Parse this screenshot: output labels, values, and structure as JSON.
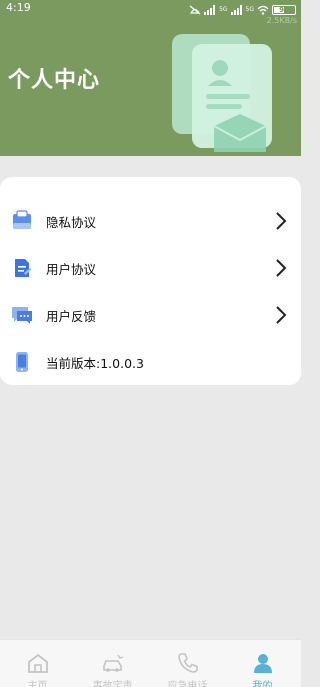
{
  "status_bar": {
    "time": "4:19",
    "battery": "96",
    "signal1_label": "5G",
    "signal2_label": "5G",
    "speed": "2.5KB/s"
  },
  "header": {
    "title": "个人中心"
  },
  "menu": {
    "items": [
      {
        "label": "隐私协议",
        "icon": "privacy-policy-icon",
        "has_arrow": true
      },
      {
        "label": "用户协议",
        "icon": "user-agreement-icon",
        "has_arrow": true
      },
      {
        "label": "用户反馈",
        "icon": "feedback-icon",
        "has_arrow": true
      },
      {
        "label": "当前版本:1.0.0.3",
        "icon": "phone-icon",
        "has_arrow": false
      }
    ]
  },
  "bottom_nav": {
    "items": [
      {
        "label": "主页",
        "icon": "home-icon",
        "active": false
      },
      {
        "label": "事故定责",
        "icon": "car-accident-icon",
        "active": false
      },
      {
        "label": "应急电话",
        "icon": "phone-call-icon",
        "active": false
      },
      {
        "label": "我的",
        "icon": "profile-icon",
        "active": true
      }
    ]
  },
  "colors": {
    "header_bg": "#7b9a60",
    "page_bg": "#e9e9ea",
    "active_tab": "#5bb0d6",
    "inactive_tab": "#c4c4c4"
  }
}
